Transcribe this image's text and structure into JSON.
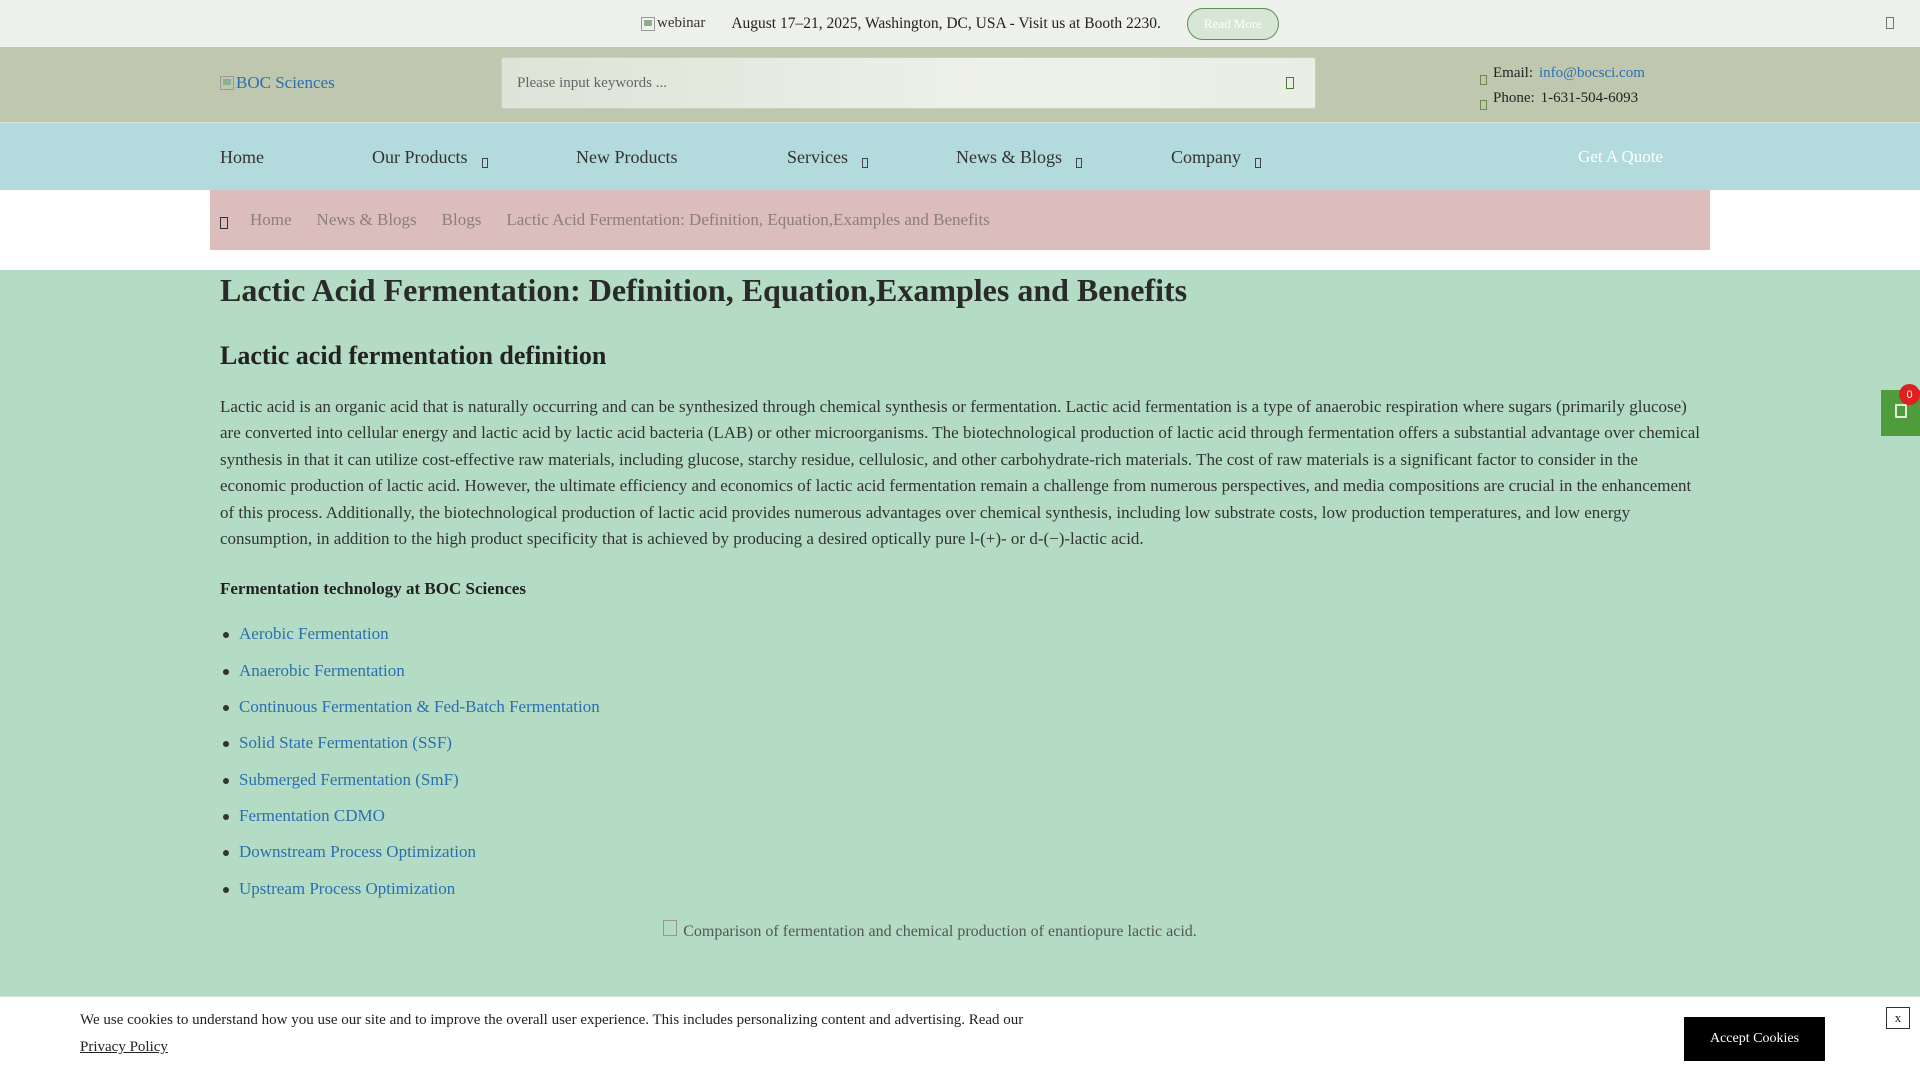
{
  "banner": {
    "image_alt": "webinar",
    "text": "August 17–21, 2025, Washington, DC, USA - Visit us at Booth 2230.",
    "button": "Read More",
    "close_icon": "close-icon"
  },
  "header": {
    "logo_alt": "BOC Sciences",
    "search_placeholder": "Please input keywords ...",
    "email_label": "Email:",
    "email": "info@bocsci.com",
    "phone_label": "Phone:",
    "phone": "1-631-504-6093"
  },
  "nav": {
    "items": [
      {
        "label": "Home",
        "dropdown": false
      },
      {
        "label": "Our Products",
        "dropdown": true
      },
      {
        "label": "New Products",
        "dropdown": false
      },
      {
        "label": "Services",
        "dropdown": true
      },
      {
        "label": "News & Blogs",
        "dropdown": true
      },
      {
        "label": "Company",
        "dropdown": true
      }
    ],
    "quote": "Get A Quote"
  },
  "breadcrumb": [
    "Home",
    "News & Blogs",
    "Blogs",
    "Lactic Acid Fermentation: Definition, Equation,Examples and Benefits"
  ],
  "article": {
    "title": "Lactic Acid Fermentation: Definition, Equation,Examples and Benefits",
    "section_title": "Lactic acid fermentation definition",
    "paragraph": "Lactic acid is an organic acid that is naturally occurring and can be synthesized through chemical synthesis or fermentation. Lactic acid fermentation is a type of anaerobic respiration where sugars (primarily glucose) are converted into cellular energy and lactic acid by lactic acid bacteria (LAB) or other microorganisms. The biotechnological production of lactic acid through fermentation offers a substantial advantage over chemical synthesis in that it can utilize cost-effective raw materials, including glucose, starchy residue, cellulosic, and other carbohydrate-rich materials. The cost of raw materials is a significant factor to consider in the economic production of lactic acid. However, the ultimate efficiency and economics of lactic acid fermentation remain a challenge from numerous perspectives, and media compositions are crucial in the enhancement of this process. Additionally, the biotechnological production of lactic acid provides numerous advantages over chemical synthesis, including low substrate costs, low production temperatures, and low energy consumption, in addition to the high product specificity that is achieved by producing a desired optically pure l-(+)- or d-(−)-lactic acid.",
    "tech_title": "Fermentation technology at BOC Sciences",
    "links": [
      "Aerobic Fermentation",
      "Anaerobic Fermentation",
      "Continuous Fermentation & Fed-Batch Fermentation",
      "Solid State Fermentation (SSF)",
      "Submerged Fermentation (SmF)",
      "Fermentation CDMO",
      "Downstream Process Optimization",
      "Upstream Process Optimization"
    ],
    "figure_alt": "Comparison of fermentation and chemical production of enantiopure lactic acid."
  },
  "cart": {
    "count": "0"
  },
  "cookie": {
    "message": "We use cookies to understand how you use our site and to improve the overall user experience. This includes personalizing content and advertising. Read our",
    "policy_link": "Privacy Policy",
    "accept": "Accept Cookies",
    "close": "x"
  },
  "colors": {
    "page_bg": "#b4dcc4",
    "link": "#2b6fb0",
    "nav_bg": "#b3dadc",
    "header_bg": "#bfc7ae",
    "breadcrumb_bg": "#dbbdbc",
    "cart_bg": "#4e9c3c"
  }
}
